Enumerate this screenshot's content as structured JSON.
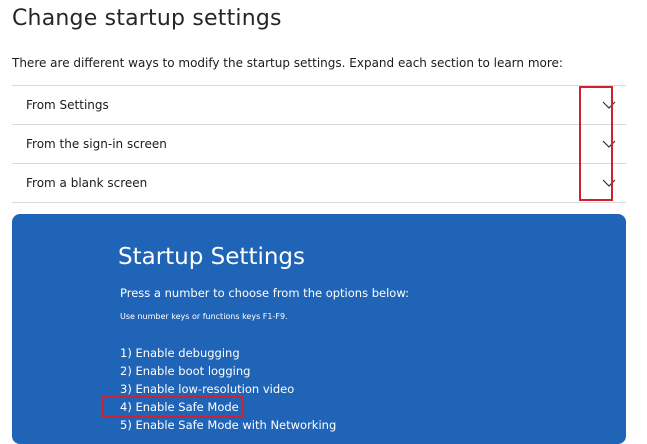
{
  "page": {
    "title": "Change startup settings",
    "intro": "There are different ways to modify the startup settings. Expand each section to learn more:"
  },
  "accordion": {
    "items": [
      {
        "label": "From Settings",
        "icon": "chevron-down-icon"
      },
      {
        "label": "From the sign-in screen",
        "icon": "chevron-down-icon"
      },
      {
        "label": "From a blank screen",
        "icon": "chevron-down-icon"
      }
    ]
  },
  "startup_screen": {
    "title": "Startup Settings",
    "prompt": "Press a number to choose from the options below:",
    "hint": "Use number keys or functions keys F1-F9.",
    "options": [
      "1) Enable debugging",
      "2) Enable boot logging",
      "3) Enable low-resolution video",
      "4) Enable Safe Mode",
      "5) Enable Safe Mode with Networking"
    ]
  },
  "colors": {
    "screen_bg": "#1f64b7",
    "highlight": "#d0222e",
    "divider": "#d9d9d9"
  }
}
